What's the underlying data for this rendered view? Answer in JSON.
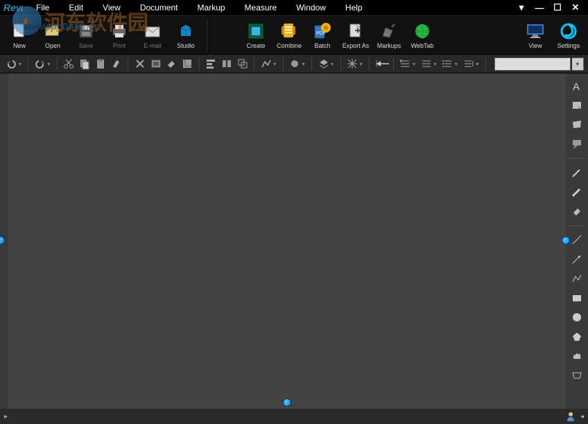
{
  "menu": {
    "items": [
      "File",
      "Edit",
      "View",
      "Document",
      "Markup",
      "Measure",
      "Window",
      "Help"
    ]
  },
  "ribbon": {
    "left": [
      {
        "name": "new",
        "label": "New"
      },
      {
        "name": "open",
        "label": "Open"
      },
      {
        "name": "save",
        "label": "Save"
      },
      {
        "name": "print",
        "label": "Print"
      },
      {
        "name": "email",
        "label": "E-mail"
      },
      {
        "name": "studio",
        "label": "Studio"
      }
    ],
    "center": [
      {
        "name": "create",
        "label": "Create"
      },
      {
        "name": "combine",
        "label": "Combine"
      },
      {
        "name": "batch",
        "label": "Batch"
      },
      {
        "name": "exportas",
        "label": "Export As"
      },
      {
        "name": "markups",
        "label": "Markups"
      },
      {
        "name": "webtab",
        "label": "WebTab"
      }
    ],
    "right": [
      {
        "name": "view",
        "label": "View"
      },
      {
        "name": "settings",
        "label": "Settings"
      }
    ]
  },
  "toolstrip": {
    "tools": [
      "undo",
      "redo",
      "cut",
      "copy",
      "paste",
      "format-paint",
      "delete",
      "snapshot",
      "tool-a",
      "tool-b",
      "highlight",
      "align-group",
      "align-group2",
      "group",
      "polyline",
      "cloud",
      "layers",
      "grid"
    ],
    "font_value": ""
  },
  "right_panel": {
    "tools": [
      "text",
      "note",
      "stamp",
      "callout",
      "cloud",
      "line",
      "eraser",
      "ruler",
      "polyline",
      "arrow",
      "polylineshape",
      "rectangle",
      "ellipse",
      "polygon",
      "ink",
      "sketch"
    ]
  },
  "watermark": {
    "text": "河东软件园",
    "url": "www.pc0359.cn"
  },
  "window_controls": {
    "pin": "▾",
    "min": "—",
    "max": "☐",
    "close": "✕"
  }
}
